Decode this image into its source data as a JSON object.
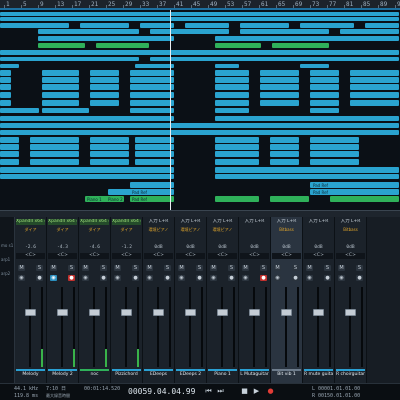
{
  "ruler": {
    "bars": [
      "1",
      "5",
      "9",
      "13",
      "17",
      "21",
      "25",
      "29",
      "33",
      "37",
      "41",
      "45",
      "49",
      "53",
      "57",
      "61",
      "65",
      "69",
      "73",
      "77",
      "81",
      "85",
      "89",
      "93"
    ]
  },
  "arrange": {
    "visible_clip_labels": [
      "Piano 1",
      "Piano 2",
      "Pad Ref",
      "Pad Ref",
      "Pad Ref",
      "Pad Ref"
    ]
  },
  "mixer": {
    "side_labels": [
      "mo s1",
      "arp1",
      "arp2"
    ],
    "channels": [
      {
        "insert": "XpandII x64 4",
        "input": "",
        "preset": "ダイア",
        "pan": "<C>",
        "volume": "-2.6",
        "name": "Melody",
        "rec": false,
        "monitor": false,
        "color": "#2aa0d3"
      },
      {
        "insert": "XpandII x64 4",
        "input": "",
        "preset": "ダイア",
        "pan": "<C>",
        "volume": "-4.3",
        "name": "Melody 2",
        "rec": true,
        "monitor": true,
        "color": "#2aa0d3"
      },
      {
        "insert": "XpandII x64 4",
        "input": "",
        "preset": "ダイア",
        "pan": "<C>",
        "volume": "-4.6",
        "name": "noc",
        "rec": false,
        "monitor": false,
        "color": "#2fb15a"
      },
      {
        "insert": "XpandII x64 4",
        "input": "",
        "preset": "ダイア",
        "pan": "<C>",
        "volume": "-1.2",
        "name": "Pizzichord",
        "rec": false,
        "monitor": false,
        "color": "#2aa0d3"
      },
      {
        "insert": "",
        "input": "入力 L+R",
        "preset": "環境ピアノ",
        "pan": "<C>",
        "volume": "0dB",
        "name": "EDeeps",
        "rec": false,
        "monitor": false,
        "color": "#2aa0d3"
      },
      {
        "insert": "",
        "input": "入力 L+R",
        "preset": "環境ピアノ",
        "pan": "<C>",
        "volume": "0dB",
        "name": "EDeeps 2",
        "rec": false,
        "monitor": false,
        "color": "#2aa0d3"
      },
      {
        "insert": "",
        "input": "入力 L+R",
        "preset": "環境ピアノ",
        "pan": "<C>",
        "volume": "0dB",
        "name": "Piano 1",
        "rec": false,
        "monitor": false,
        "color": "#2aa0d3"
      },
      {
        "insert": "",
        "input": "入力 L+R",
        "preset": "",
        "pan": "<C>",
        "volume": "0dB",
        "name": "L Mutaguitar",
        "rec": true,
        "monitor": false,
        "color": "#2aa0d3"
      },
      {
        "insert": "",
        "input": "入力 L+R",
        "preset": "Bitbass",
        "pan": "<C>",
        "volume": "0dB",
        "name": "Bit vib 1",
        "rec": false,
        "monitor": false,
        "color": "#6d7c8c",
        "selected": true
      },
      {
        "insert": "",
        "input": "入力 L+R",
        "preset": "",
        "pan": "<C>",
        "volume": "0dB",
        "name": "R mute guitar",
        "rec": false,
        "monitor": false,
        "color": "#2aa0d3"
      },
      {
        "insert": "",
        "input": "入力 L+R",
        "preset": "Bitbass",
        "pan": "<C>",
        "volume": "0dB",
        "name": "R choirguitar",
        "rec": false,
        "monitor": false,
        "color": "#2aa0d3"
      }
    ]
  },
  "transport": {
    "sample_rate": "44.1 kHz",
    "disk": "119.8 ms",
    "record_time": "7:10 日",
    "record_time_sub": "最大録音時間",
    "duration": "00:01:14.520",
    "position": "00059.04.04.99",
    "left_locator": "L 00001.01.01.00",
    "right_locator": "R 00150.01.01.00",
    "buttons": [
      "rewind-icon",
      "forward-icon",
      "stop-icon",
      "play-icon",
      "record-icon"
    ]
  },
  "colors": {
    "clip_blue": "#2aa3cf",
    "clip_green": "#2fb15a",
    "background": "#0e1319"
  }
}
